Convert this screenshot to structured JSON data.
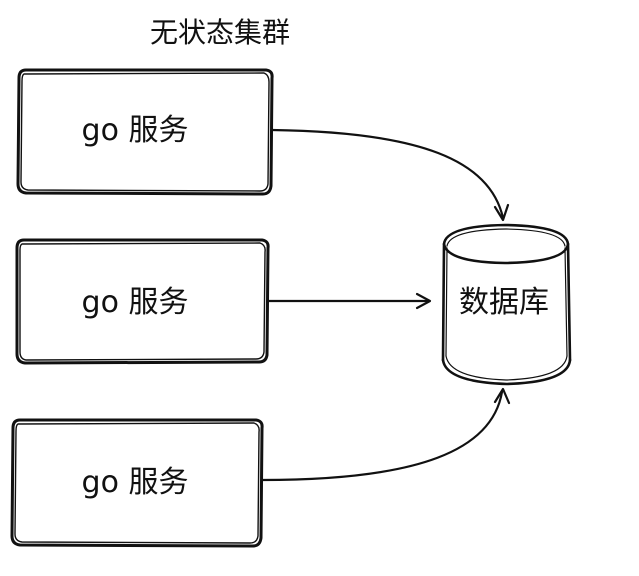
{
  "diagram": {
    "title": "无状态集群",
    "services": [
      {
        "label": "go 服务"
      },
      {
        "label": "go 服务"
      },
      {
        "label": "go 服务"
      }
    ],
    "database": {
      "label": "数据库",
      "icon": "database-cylinder-icon"
    },
    "colors": {
      "stroke": "#111111",
      "background": "#ffffff"
    }
  }
}
